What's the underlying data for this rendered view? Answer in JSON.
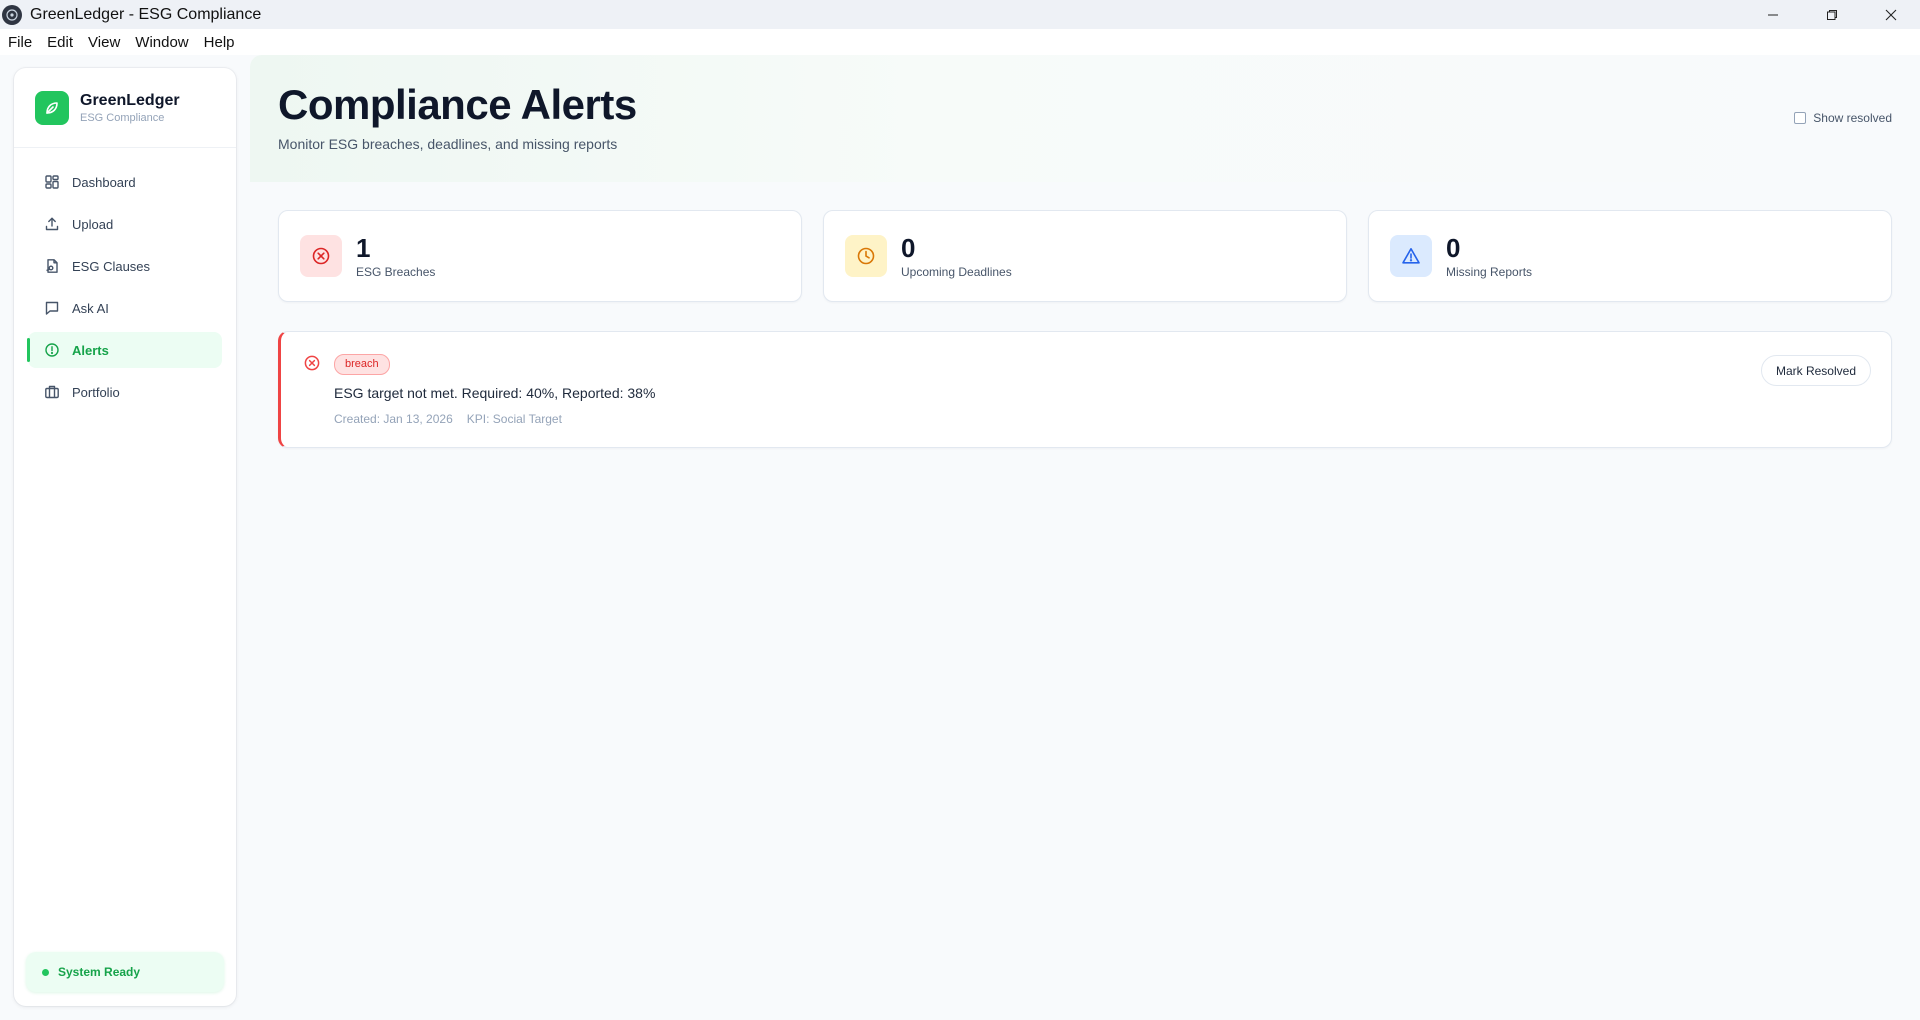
{
  "window": {
    "title": "GreenLedger - ESG Compliance",
    "controls": [
      "minimize-icon",
      "restore-icon",
      "close-icon"
    ]
  },
  "menu": [
    "File",
    "Edit",
    "View",
    "Window",
    "Help"
  ],
  "sidebar": {
    "brand_name": "GreenLedger",
    "brand_sub": "ESG Compliance",
    "items": [
      {
        "label": "Dashboard",
        "icon": "dashboard-icon"
      },
      {
        "label": "Upload",
        "icon": "upload-icon"
      },
      {
        "label": "ESG Clauses",
        "icon": "document-icon"
      },
      {
        "label": "Ask AI",
        "icon": "chat-icon"
      },
      {
        "label": "Alerts",
        "icon": "alert-circle-icon",
        "active": true
      },
      {
        "label": "Portfolio",
        "icon": "briefcase-icon"
      }
    ],
    "status": "System Ready"
  },
  "header": {
    "title": "Compliance Alerts",
    "subtitle": "Monitor ESG breaches, deadlines, and missing reports",
    "show_resolved_label": "Show resolved",
    "show_resolved_checked": false
  },
  "stats": [
    {
      "value": "1",
      "label": "ESG Breaches",
      "icon": "x-circle-icon",
      "bg": "#fee2e2",
      "color": "#dc2626"
    },
    {
      "value": "0",
      "label": "Upcoming Deadlines",
      "icon": "clock-icon",
      "bg": "#fef3c7",
      "color": "#d97706"
    },
    {
      "value": "0",
      "label": "Missing Reports",
      "icon": "warning-triangle-icon",
      "bg": "#dbeafe",
      "color": "#2563eb"
    }
  ],
  "alerts": [
    {
      "type": "breach",
      "message": "ESG target not met. Required: 40%, Reported: 38%",
      "created": "Created: Jan 13, 2026",
      "kpi": "KPI: Social Target",
      "action_label": "Mark Resolved"
    }
  ],
  "colors": {
    "accent": "#22c55e",
    "breach": "#ef4444"
  }
}
